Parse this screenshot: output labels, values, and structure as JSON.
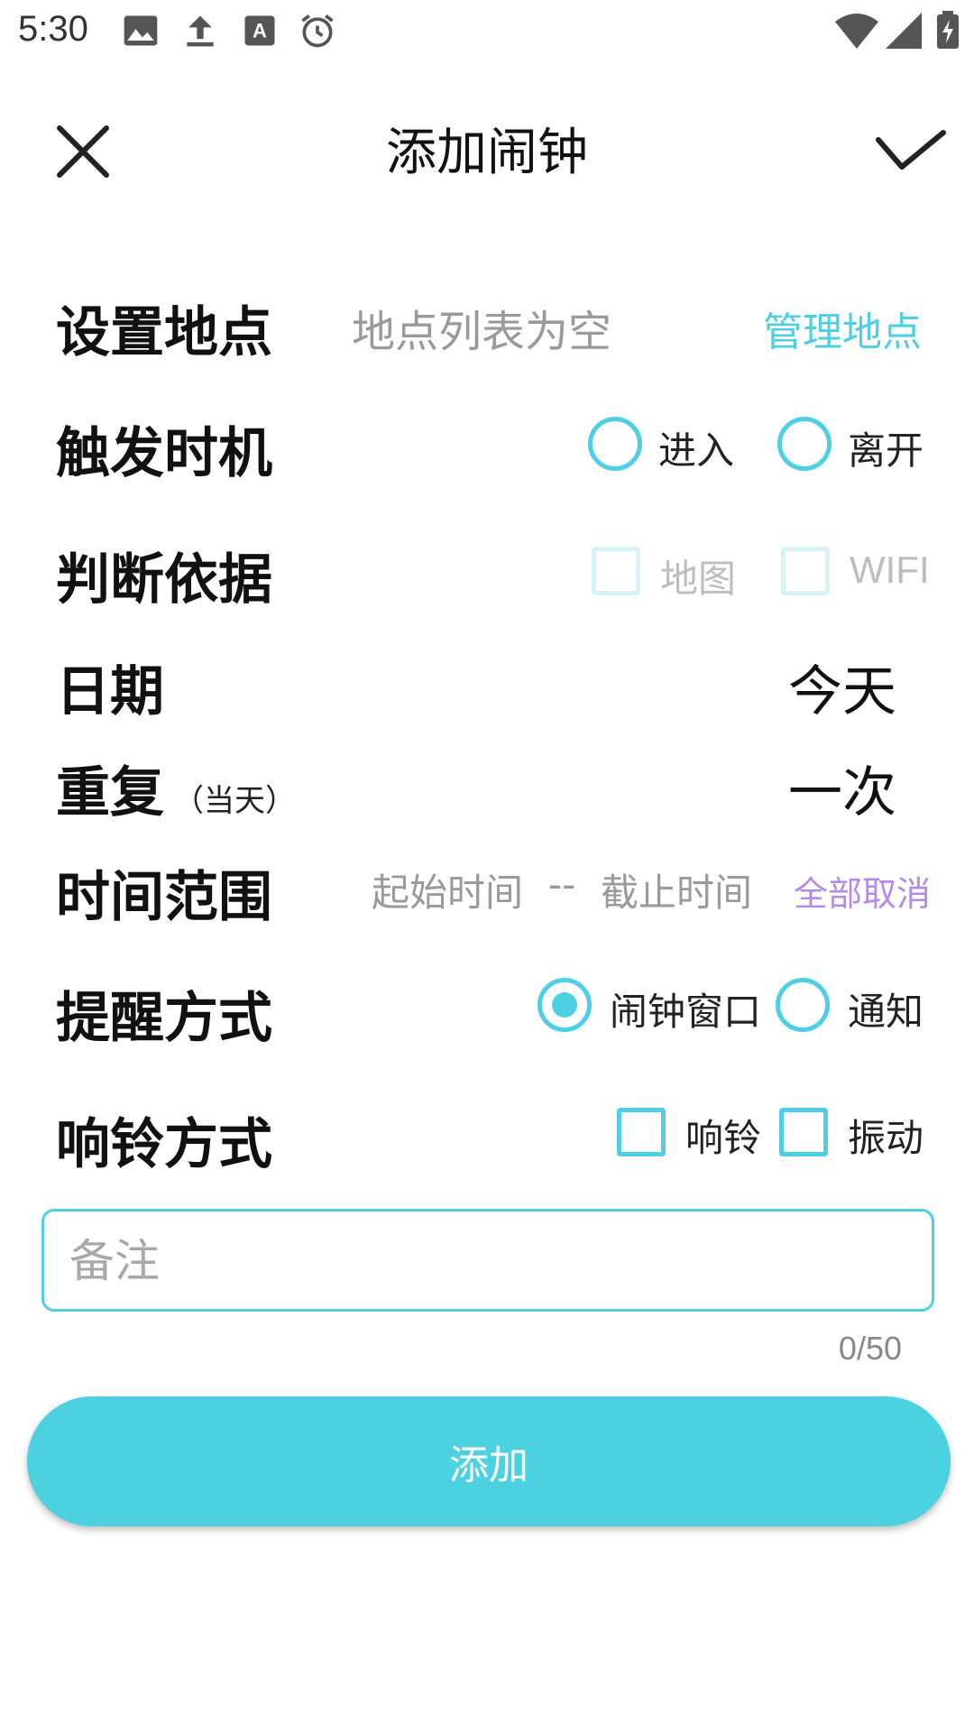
{
  "status_bar": {
    "time": "5:30",
    "icons": [
      "image-icon",
      "upload-icon",
      "font-icon",
      "alarm-icon",
      "wifi-icon",
      "signal-icon",
      "battery-charging-icon"
    ]
  },
  "toolbar": {
    "title": "添加闹钟",
    "close_icon": "close-icon",
    "confirm_icon": "check-icon"
  },
  "location": {
    "label": "设置地点",
    "empty_text": "地点列表为空",
    "manage_link": "管理地点"
  },
  "trigger": {
    "label": "触发时机",
    "options": [
      "进入",
      "离开"
    ]
  },
  "basis": {
    "label": "判断依据",
    "options": [
      "地图",
      "WIFI"
    ]
  },
  "date": {
    "label": "日期",
    "value": "今天"
  },
  "repeat": {
    "label": "重复",
    "sub": "（当天）",
    "value": "一次"
  },
  "time_range": {
    "label": "时间范围",
    "start": "起始时间",
    "separator": "--",
    "end": "截止时间",
    "cancel_all": "全部取消"
  },
  "reminder": {
    "label": "提醒方式",
    "options": [
      "闹钟窗口",
      "通知"
    ],
    "selected": "闹钟窗口"
  },
  "ring": {
    "label": "响铃方式",
    "options": [
      "响铃",
      "振动"
    ]
  },
  "remark": {
    "placeholder": "备注",
    "value": "",
    "counter": "0/50"
  },
  "add_button": {
    "label": "添加"
  },
  "colors": {
    "accent": "#4fcfe3",
    "button": "#4bd1e0",
    "purple_link": "#b48be6"
  }
}
